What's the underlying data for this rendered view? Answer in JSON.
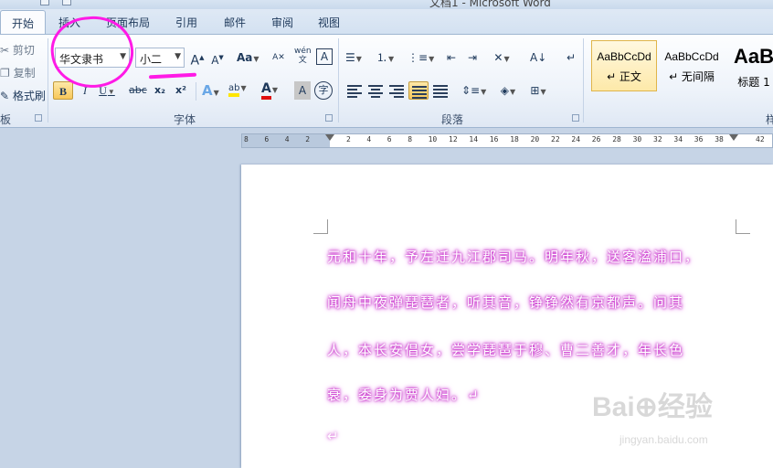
{
  "window": {
    "title": "文档1 - Microsoft Word"
  },
  "tabs": [
    {
      "label": "开始"
    },
    {
      "label": "插入"
    },
    {
      "label": "页面布局"
    },
    {
      "label": "引用"
    },
    {
      "label": "邮件"
    },
    {
      "label": "审阅"
    },
    {
      "label": "视图"
    }
  ],
  "clipboard": {
    "cut": "剪切",
    "copy": "复制",
    "format_painter": "格式刷",
    "label": "板"
  },
  "font": {
    "name": "华文隶书",
    "size": "小二",
    "grow_label": "A",
    "shrink_label": "A",
    "case_label": "Aa",
    "pinyin_label": "wén",
    "bold": "B",
    "italic": "I",
    "underline": "U",
    "strike": "abc",
    "subscript": "x₂",
    "superscript": "x²",
    "effects": "A",
    "highlight": "ab",
    "color": "A",
    "charshade": "A",
    "enclose": "字",
    "group_label": "字体"
  },
  "paragraph": {
    "group_label": "段落"
  },
  "styles": {
    "items": [
      {
        "sample": "AaBbCcDd",
        "name": "↵ 正文"
      },
      {
        "sample": "AaBbCcDd",
        "name": "↵ 无间隔"
      },
      {
        "sample": "AaB",
        "name": "标题 1"
      }
    ],
    "group_label": "样"
  },
  "ruler": {
    "ticks": [
      "8",
      "6",
      "4",
      "2",
      "",
      "2",
      "4",
      "6",
      "8",
      "10",
      "12",
      "14",
      "16",
      "18",
      "20",
      "22",
      "24",
      "26",
      "28",
      "30",
      "32",
      "34",
      "36",
      "38",
      "",
      "42"
    ]
  },
  "document": {
    "lines": [
      "元和十年，予左迁九江郡司马。明年秋，送客湓浦口，",
      "闻舟中夜弹琵琶者，听其音，铮铮然有京都声。问其",
      "人，本长安倡女，尝学琵琶于穆、曹二善才，年长色",
      "衰，委身为贾人妇。↵"
    ],
    "end_mark": "↵"
  },
  "watermark": {
    "brand": "Bai⊕经验",
    "url": "jingyan.baidu.com"
  },
  "colors": {
    "annotation": "#ff1ae6",
    "glow": "#cc3fcf",
    "highlight": "#ffe600",
    "font_red": "#e01010"
  }
}
